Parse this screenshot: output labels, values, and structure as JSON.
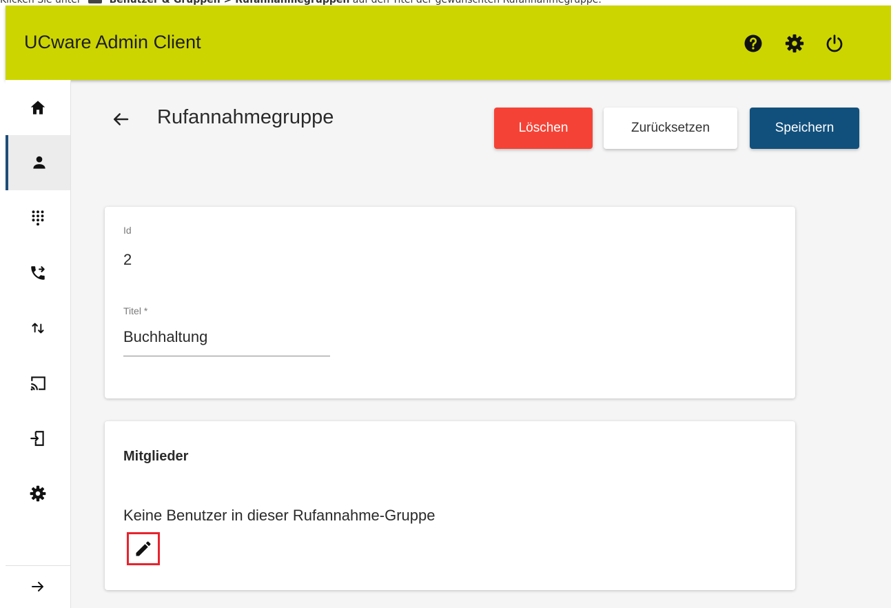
{
  "caption": {
    "prefix": "Klicken Sie unter",
    "menu_path": "Benutzer & Gruppen > Rufannahmegruppen",
    "suffix": "auf den Titel der gewünschten Rufannahmegruppe."
  },
  "app": {
    "title": "UCware Admin Client",
    "accent_color": "#ccd500",
    "top_icons": [
      "help-icon",
      "settings-icon",
      "power-icon"
    ]
  },
  "sidebar": {
    "items": [
      {
        "icon": "home-icon"
      },
      {
        "icon": "person-icon",
        "active": true
      },
      {
        "icon": "dialpad-icon"
      },
      {
        "icon": "phone-forward-icon"
      },
      {
        "icon": "swap-vert-icon"
      },
      {
        "icon": "cast-icon"
      },
      {
        "icon": "login-icon"
      },
      {
        "icon": "gear-icon"
      }
    ],
    "expand_icon": "arrow-right-icon"
  },
  "header": {
    "title": "Rufannahmegruppe",
    "buttons": {
      "delete": "Löschen",
      "reset": "Zurücksetzen",
      "save": "Speichern"
    }
  },
  "details": {
    "id_label": "Id",
    "id_value": "2",
    "title_label": "Titel *",
    "title_value": "Buchhaltung"
  },
  "members": {
    "heading": "Mitglieder",
    "empty_text": "Keine Benutzer in dieser Rufannahme-Gruppe",
    "edit_icon": "pencil-icon"
  },
  "colors": {
    "delete": "#f44336",
    "save": "#11507c",
    "highlight": "#e8232d"
  }
}
